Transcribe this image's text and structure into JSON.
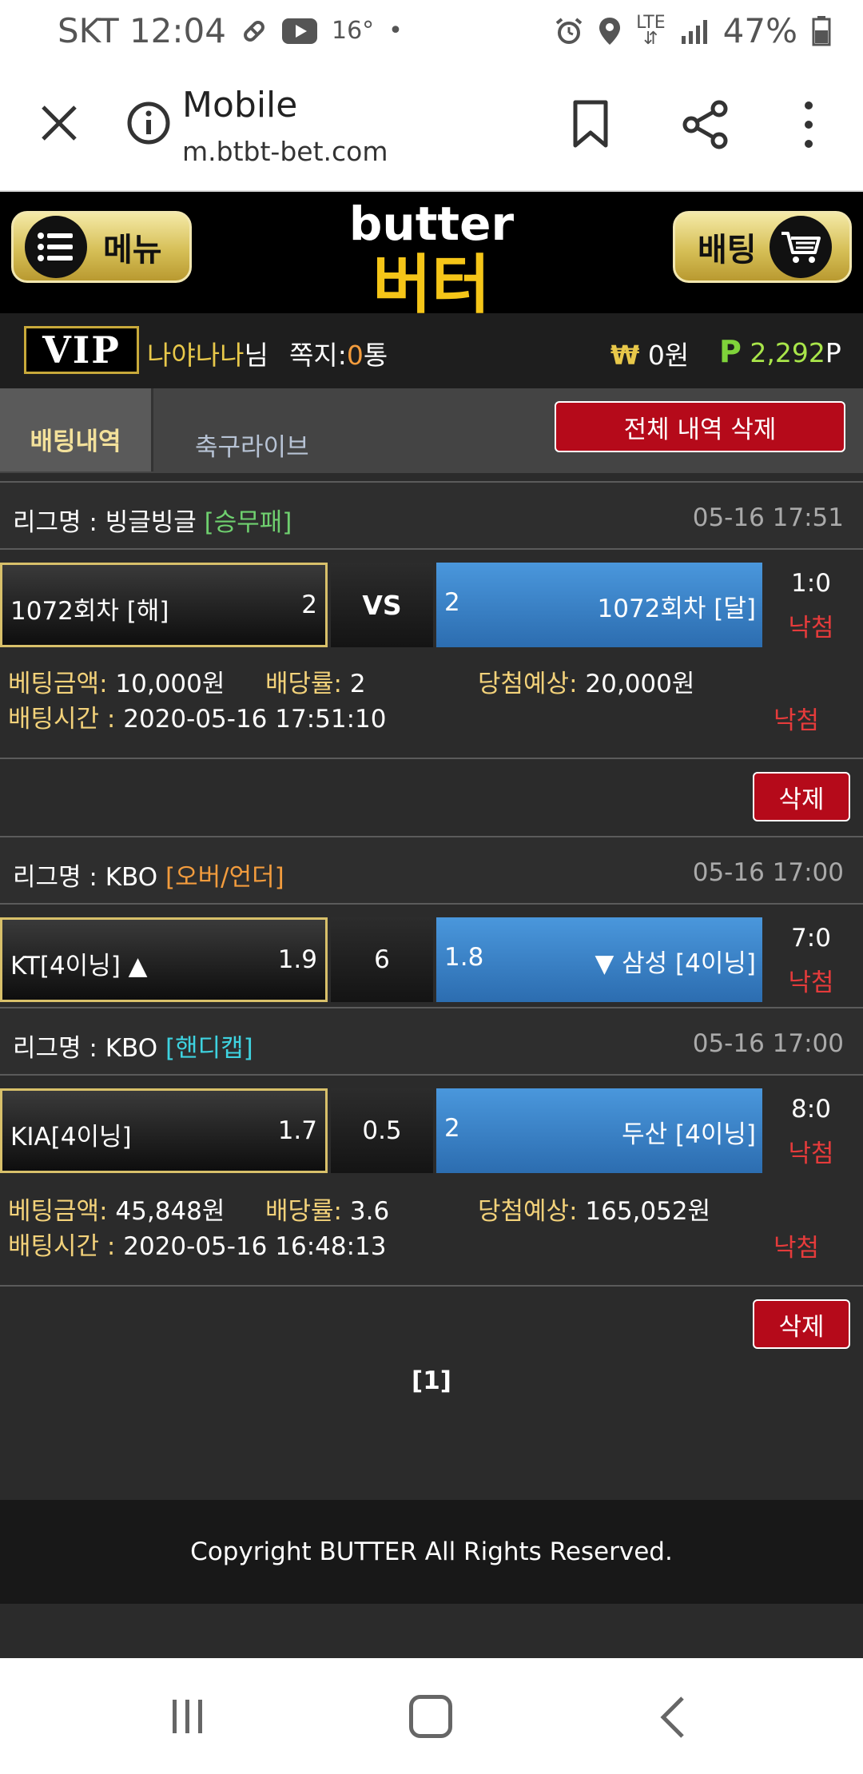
{
  "status_bar": {
    "carrier_time": "SKT 12:04",
    "temperature": "16°",
    "dot": "•",
    "lte": "LTE",
    "battery": "47%"
  },
  "browser": {
    "title": "Mobile",
    "url": "m.btbt-bet.com"
  },
  "header": {
    "menu_label": "메뉴",
    "bet_label": "배팅",
    "logo_text_en": "butter",
    "logo_text_ko": "버터"
  },
  "user": {
    "vip": "VIP",
    "name": "나야나나",
    "honorific": "님",
    "memo_label": "쪽지:",
    "memo_count": "0",
    "memo_unit": "통",
    "won_icon": "₩",
    "money": "0원",
    "points_icon": "P",
    "points": "2,292",
    "points_unit": "P"
  },
  "tabs": {
    "active": "배팅내역",
    "other": "축구라이브",
    "delete_all": "전체 내역 삭제"
  },
  "bets": [
    {
      "games": [
        {
          "league_label": "리그명 : 빙글빙글",
          "market": "[승무패]",
          "market_color": "#6fd06f",
          "date": "05-16 17:51",
          "home": "1072회차 [해]",
          "home_odds": "2",
          "middle": "VS",
          "away_odds": "2",
          "away": "1072회차 [달]",
          "home_arrow": "",
          "away_arrow": "",
          "score": "1:0",
          "result": "낙첨"
        }
      ],
      "info": {
        "amount_label": "베팅금액:",
        "amount": "10,000원",
        "rate_label": "배당률:",
        "rate": "2",
        "expected_label": "당첨예상:",
        "expected": "20,000원",
        "time_label": "배팅시간 :",
        "time": "2020-05-16 17:51:10",
        "result": "낙첨"
      },
      "delete_label": "삭제"
    },
    {
      "games": [
        {
          "league_label": "리그명 : KBO",
          "market": "[오버/언더]",
          "market_color": "#f39c3d",
          "date": "05-16 17:00",
          "home": "KT[4이닝]",
          "home_arrow": "▲",
          "home_odds": "1.9",
          "middle": "6",
          "away_odds": "1.8",
          "away_arrow": "▼",
          "away": "삼성 [4이닝]",
          "score": "7:0",
          "result": "낙첨"
        },
        {
          "league_label": "리그명 : KBO",
          "market": "[핸디캡]",
          "market_color": "#3ed3e0",
          "date": "05-16 17:00",
          "home": "KIA[4이닝]",
          "home_arrow": "",
          "home_odds": "1.7",
          "middle": "0.5",
          "away_odds": "2",
          "away_arrow": "",
          "away": "두산 [4이닝]",
          "score": "8:0",
          "result": "낙첨"
        }
      ],
      "info": {
        "amount_label": "베팅금액:",
        "amount": "45,848원",
        "rate_label": "배당률:",
        "rate": "3.6",
        "expected_label": "당첨예상:",
        "expected": "165,052원",
        "time_label": "배팅시간 :",
        "time": "2020-05-16 16:48:13",
        "result": "낙첨"
      },
      "delete_label": "삭제"
    }
  ],
  "pagination": "[1]",
  "footer": "Copyright BUTTER All Rights Reserved."
}
